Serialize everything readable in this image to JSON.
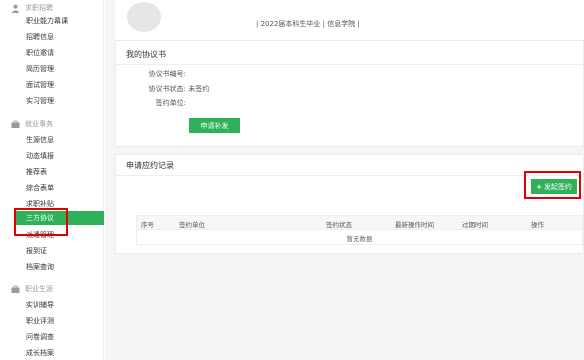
{
  "sidebar": {
    "groups": [
      {
        "title": "求职招聘",
        "icon": "person-icon",
        "items": [
          "职业能力幕课",
          "招聘信息",
          "职位邀请",
          "简历管理",
          "面试管理",
          "实习管理"
        ]
      },
      {
        "title": "就业事务",
        "icon": "briefcase-icon",
        "items": [
          "生源信息",
          "动态填报",
          "推荐表",
          "综合表单",
          "求职补贴",
          "三方协议",
          "派遣管理",
          "报到证",
          "档案查询"
        ]
      },
      {
        "title": "职业生涯",
        "icon": "briefcase-icon",
        "items": [
          "实训辅导",
          "职业评测",
          "问卷调查",
          "成长档案"
        ]
      }
    ],
    "active_item": "三方协议"
  },
  "header": {
    "info": "| 2022届本科生毕业 | 信息学院 |"
  },
  "agreement": {
    "title": "我的协议书",
    "number_label": "协议书编号:",
    "number_value": "",
    "status_label": "协议书状态:",
    "status_value": "未签约",
    "unit_label": "签约单位:",
    "unit_value": "",
    "apply_button": "申请补发"
  },
  "records": {
    "title": "申请应约记录",
    "initiate_button": "发起签约",
    "columns": [
      "序号",
      "签约单位",
      "签约状态",
      "最新操作时间",
      "过期时间",
      "操作"
    ],
    "empty_text": "暂无数据"
  },
  "colors": {
    "accent": "#2fb15a",
    "highlight": "#e00000"
  }
}
